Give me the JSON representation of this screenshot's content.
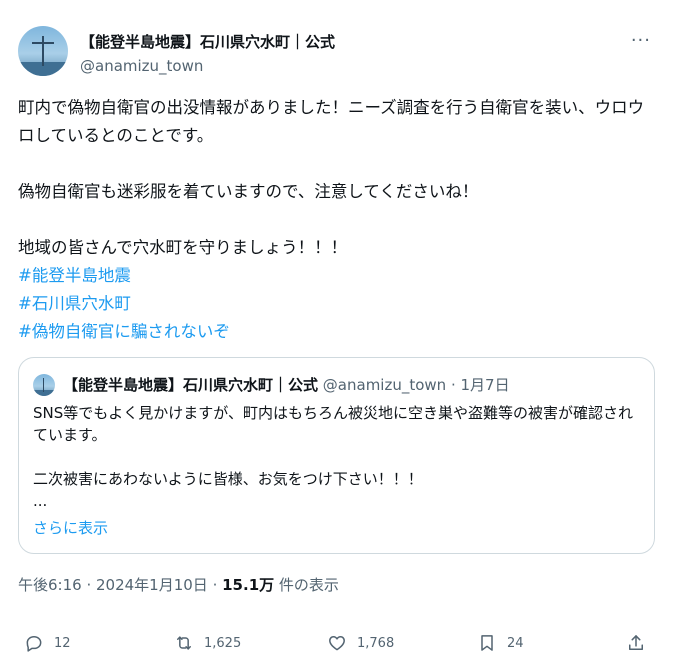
{
  "author": {
    "name": "【能登半島地震】石川県穴水町｜公式",
    "handle": "@anamizu_town"
  },
  "more_icon": "more-dots-icon",
  "post": {
    "line1": "町内で偽物自衛官の出没情報がありました！ニーズ調査を行う自衛官を装い、ウロウロしているとのことです。",
    "line2": "偽物自衛官も迷彩服を着ていますので、注意してくださいね！",
    "line3": "地域の皆さんで穴水町を守りましょう！！！",
    "hashtags": [
      "#能登半島地震",
      "#石川県穴水町",
      "#偽物自衛官に騙されないぞ"
    ]
  },
  "quote": {
    "name": "【能登半島地震】石川県穴水町｜公式",
    "handle": "@anamizu_town",
    "separator": " · ",
    "date": "1月7日",
    "text": "SNS等でもよく見かけますが、町内はもちろん被災地に空き巣や盗難等の被害が確認されています。\n\n二次被害にあわないように皆様、お気をつけ下さい！！！\n...",
    "show_more": "さらに表示"
  },
  "meta": {
    "time": "午後6:16",
    "separator": " · ",
    "date": "2024年1月10日",
    "separator2": " · ",
    "views": "15.1万",
    "views_label": " 件の表示"
  },
  "actions": {
    "replies": "12",
    "reposts": "1,625",
    "likes": "1,768",
    "bookmarks": "24"
  },
  "colors": {
    "link": "#1d9bf0",
    "muted": "#536471",
    "text": "#0f1419",
    "border": "#cfd9de"
  }
}
